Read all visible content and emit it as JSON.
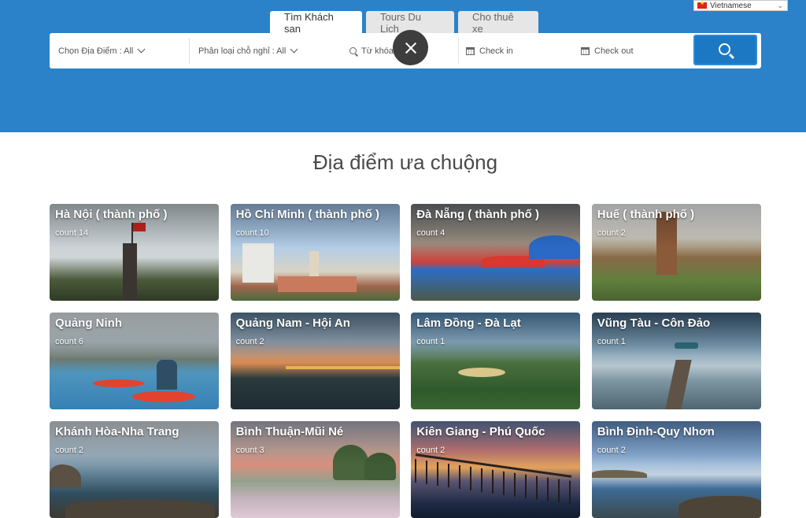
{
  "language": {
    "label": "Vietnamese"
  },
  "tabs": [
    {
      "label": "Tìm Khách sạn",
      "active": true
    },
    {
      "label": "Tours Du Lịch",
      "active": false
    },
    {
      "label": "Cho thuê xe",
      "active": false
    }
  ],
  "search": {
    "location_label": "Chọn Địa Điểm : All",
    "type_label": "Phân loại chỗ nghỉ : All",
    "keyword_placeholder": "Từ khóa",
    "checkin_label": "Check in",
    "checkout_label": "Check out"
  },
  "section_title": "Địa điểm ưa chuộng",
  "count_prefix": "count",
  "destinations": [
    {
      "name": "Hà Nội ( thành phố )",
      "count": "14"
    },
    {
      "name": "Hồ Chí Minh ( thành phố )",
      "count": "10"
    },
    {
      "name": "Đà Nẵng ( thành phố )",
      "count": "4"
    },
    {
      "name": "Huế ( thành phố )",
      "count": "2"
    },
    {
      "name": "Quảng Ninh",
      "count": "6"
    },
    {
      "name": "Quảng Nam - Hội An",
      "count": "2"
    },
    {
      "name": "Lâm Đồng - Đà Lạt",
      "count": "1"
    },
    {
      "name": "Vũng Tàu - Côn Đảo",
      "count": "1"
    },
    {
      "name": "Khánh Hòa-Nha Trang",
      "count": "2"
    },
    {
      "name": "Bình Thuận-Mũi Né",
      "count": "3"
    },
    {
      "name": "Kiên Giang - Phú Quốc",
      "count": "2"
    },
    {
      "name": "Bình Định-Quy Nhơn",
      "count": "2"
    }
  ],
  "colors": {
    "hero": "#2b82c9",
    "button": "#1c78c3"
  }
}
